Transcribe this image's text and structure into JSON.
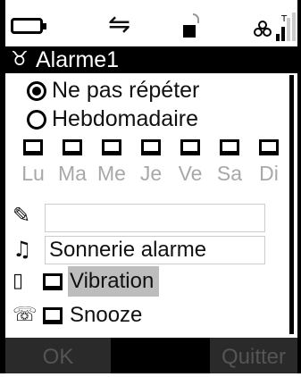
{
  "status_bar": {
    "battery_icon": "battery-icon",
    "sync_icon": "sync-arrows-icon",
    "lock_icon": "lock-icon",
    "signal_icon": "signal-strength-icon"
  },
  "title_bar": {
    "icon": "alarm-icon",
    "title": "Alarme1"
  },
  "repeat_options": [
    {
      "label": "Ne pas répéter",
      "selected": true
    },
    {
      "label": "Hebdomadaire",
      "selected": false
    }
  ],
  "days": [
    {
      "label": "Lu"
    },
    {
      "label": "Ma"
    },
    {
      "label": "Me"
    },
    {
      "label": "Je"
    },
    {
      "label": "Ve"
    },
    {
      "label": "Sa"
    },
    {
      "label": "Di"
    }
  ],
  "fields": {
    "name_value": "",
    "ringtone_value": "Sonnerie alarme"
  },
  "options": {
    "vibration_label": "Vibration",
    "vibration_checked": false,
    "snooze_label": "Snooze",
    "snooze_checked": false
  },
  "softkeys": {
    "left": "OK",
    "right": "Quitter"
  }
}
